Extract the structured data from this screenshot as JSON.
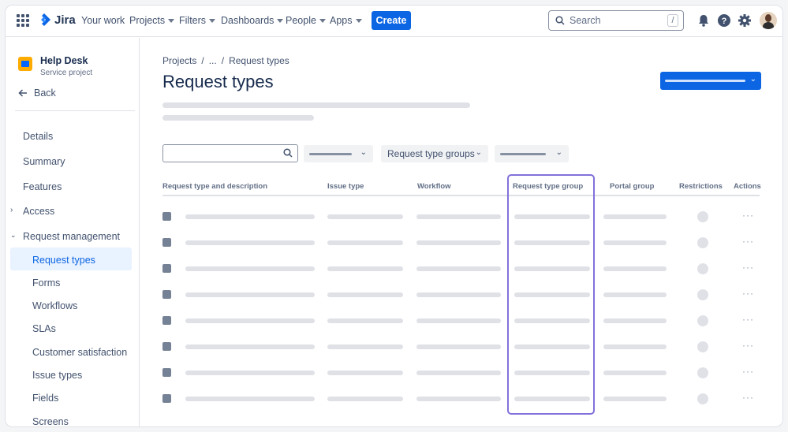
{
  "topnav": {
    "logo_text": "Jira",
    "items": [
      {
        "label": "Your work",
        "caret": false
      },
      {
        "label": "Projects",
        "caret": true
      },
      {
        "label": "Filters",
        "caret": true
      },
      {
        "label": "Dashboards",
        "caret": true
      },
      {
        "label": "People",
        "caret": true
      },
      {
        "label": "Apps",
        "caret": true
      }
    ],
    "create_label": "Create",
    "search_placeholder": "Search",
    "search_shortcut": "/",
    "icons": [
      "notification-icon",
      "help-icon",
      "settings-icon",
      "avatar"
    ]
  },
  "sidebar": {
    "project_name": "Help Desk",
    "project_type": "Service project",
    "back_label": "Back",
    "items": [
      {
        "label": "Details"
      },
      {
        "label": "Summary"
      },
      {
        "label": "Features"
      },
      {
        "label": "Access"
      },
      {
        "label": "Request management"
      }
    ],
    "sub_items": [
      {
        "label": "Request types",
        "active": true
      },
      {
        "label": "Forms"
      },
      {
        "label": "Workflows"
      },
      {
        "label": "SLAs"
      },
      {
        "label": "Customer satisfaction"
      },
      {
        "label": "Issue types"
      },
      {
        "label": "Fields"
      },
      {
        "label": "Screens"
      }
    ]
  },
  "main": {
    "breadcrumb": [
      "Projects",
      "...",
      "Request types"
    ],
    "title": "Request types",
    "filters": {
      "group_dropdown_label": "Request type groups"
    },
    "columns": [
      "Request type and description",
      "Issue type",
      "Workflow",
      "Request type group",
      "Portal group",
      "Restrictions",
      "Actions"
    ],
    "highlighted_column": "Request type group",
    "actions_glyph": "···",
    "row_count": 8
  },
  "colors": {
    "brand": "#0c66e4",
    "highlight": "#8270db",
    "skeleton": "#dfe1e6",
    "active_nav_bg": "#e9f2ff"
  }
}
